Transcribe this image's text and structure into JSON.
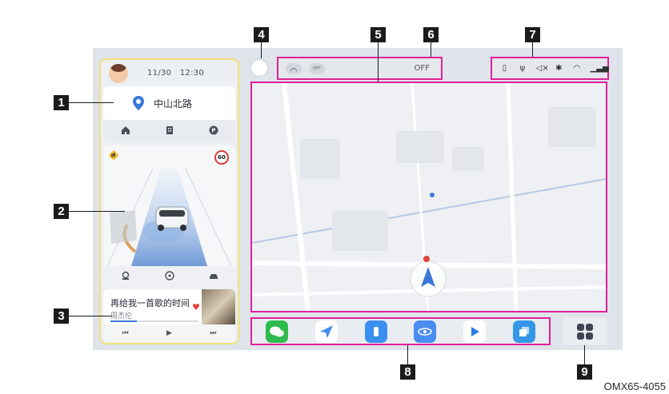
{
  "status_bar": {
    "date": "11/30",
    "time": "12:30"
  },
  "navigation": {
    "road_name": "中山北路",
    "icons": [
      "home-icon",
      "building-icon",
      "parking-icon"
    ]
  },
  "adas": {
    "pedestrian_icon": "pedestrian-warning-icon",
    "speed_limit": "60",
    "icons": [
      "lane-assist-icon",
      "steering-wheel-icon",
      "car-icon"
    ]
  },
  "music": {
    "song": "再给我一首歌的时间",
    "artist": "周杰伦",
    "progress": 0.3,
    "controls": [
      "⏮",
      "▶",
      "⏭"
    ]
  },
  "climate": {
    "off_label": "OFF",
    "toggle_label": "OFF"
  },
  "system_status_icons": [
    "battery-icon",
    "usb-icon",
    "mute-icon",
    "bluetooth-icon",
    "wifi-icon",
    "signal-icon"
  ],
  "dock_apps": [
    {
      "name": "wechat",
      "color": "#2dbb4e"
    },
    {
      "name": "navigation",
      "color": "#3f8ee8"
    },
    {
      "name": "phone",
      "color": "#3a8ff0"
    },
    {
      "name": "camera-540",
      "color": "#4a8df0"
    },
    {
      "name": "video",
      "color": "#2b7de9"
    },
    {
      "name": "multitask",
      "color": "#3497e8"
    }
  ],
  "callouts": [
    "1",
    "2",
    "3",
    "4",
    "5",
    "6",
    "7",
    "8",
    "9"
  ],
  "figure_code": "OMX65-4055",
  "colors": {
    "highlight_border": "#e0219a",
    "left_panel_border": "#f1e37a",
    "accent_blue": "#3b78d8"
  }
}
